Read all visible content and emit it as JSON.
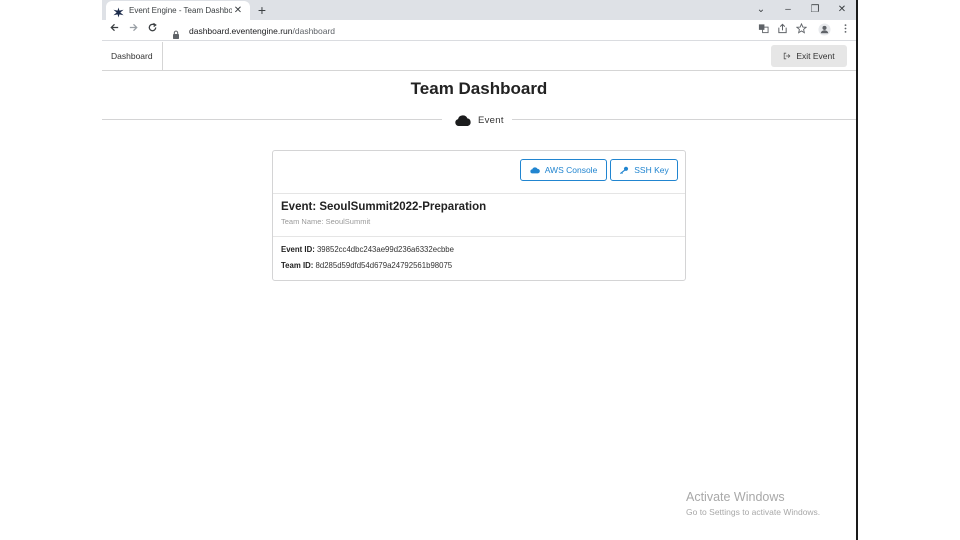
{
  "browser": {
    "tab_title": "Event Engine - Team Dashboard",
    "tab_close": "✕",
    "new_tab": "+",
    "url_host": "dashboard.eventengine.run",
    "url_path": "/dashboard",
    "window_controls": {
      "dropdown": "⌄",
      "minimize": "–",
      "restore": "❐",
      "close": "✕"
    }
  },
  "nav": {
    "dashboard_label": "Dashboard",
    "exit_label": "Exit Event"
  },
  "page": {
    "title": "Team Dashboard",
    "divider_label": "Event"
  },
  "card": {
    "aws_console_label": "AWS Console",
    "ssh_key_label": "SSH Key",
    "event_header": "Event: SeoulSummit2022-Preparation",
    "team_name": "Team Name: SeoulSummit",
    "event_id_label": "Event ID:",
    "event_id_value": "39852cc4dbc243ae99d236a6332ecbbe",
    "team_id_label": "Team ID:",
    "team_id_value": "8d285d59dfd54d679a24792561b98075"
  },
  "watermark": {
    "title": "Activate Windows",
    "subtitle": "Go to Settings to activate Windows."
  },
  "colors": {
    "accent_blue": "#2185d0",
    "tabstrip": "#dee1e6"
  }
}
